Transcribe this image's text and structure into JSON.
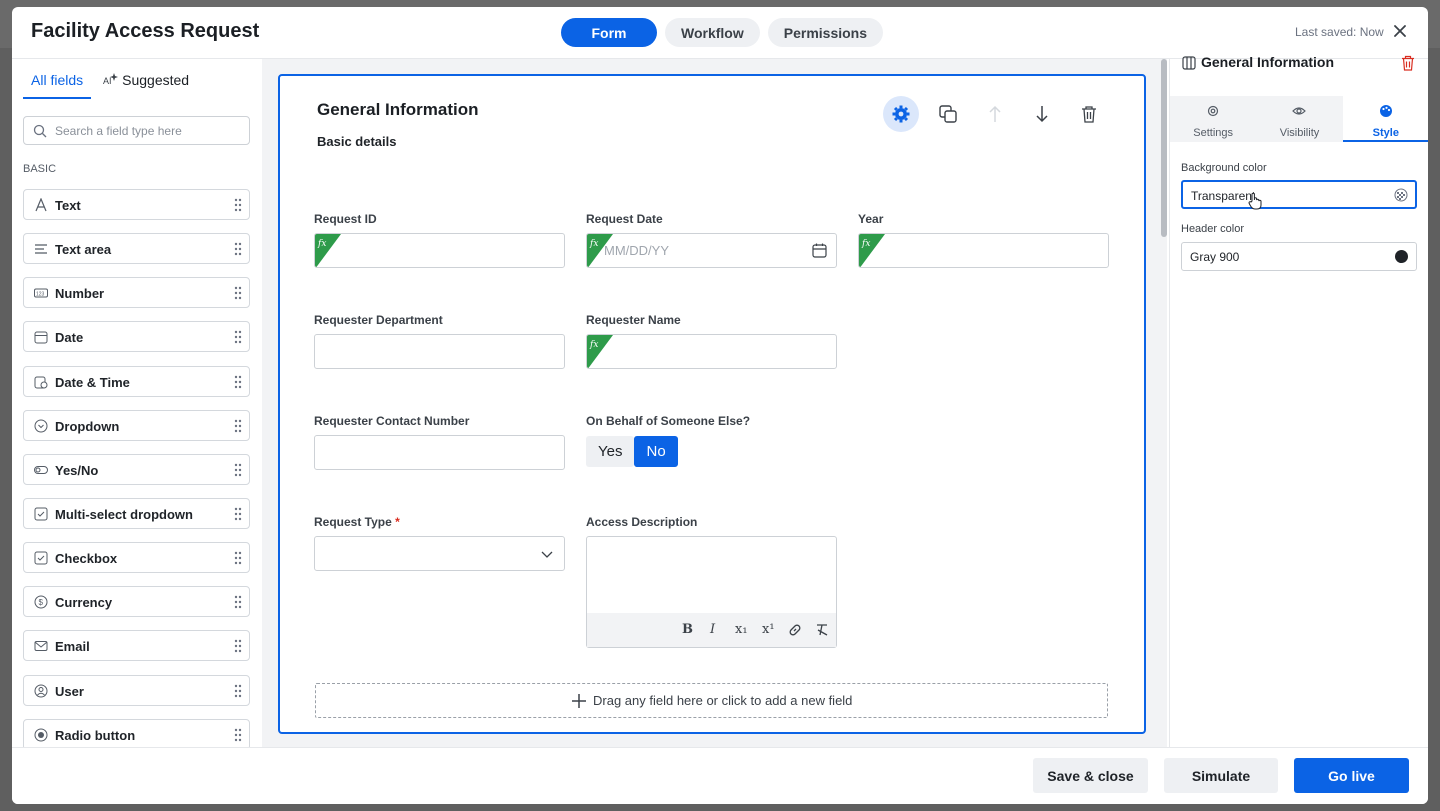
{
  "header": {
    "title": "Facility Access Request",
    "tabs": [
      "Form",
      "Workflow",
      "Permissions"
    ],
    "active_tab": "Form",
    "saved_status": "Last saved: Now"
  },
  "left_panel": {
    "tabs": [
      "All fields",
      "Suggested"
    ],
    "search_placeholder": "Search a field type here",
    "section_label": "BASIC",
    "field_types": [
      {
        "label": "Text",
        "icon": "text-icon"
      },
      {
        "label": "Text area",
        "icon": "textarea-icon"
      },
      {
        "label": "Number",
        "icon": "number-icon"
      },
      {
        "label": "Date",
        "icon": "calendar-icon"
      },
      {
        "label": "Date & Time",
        "icon": "datetime-icon"
      },
      {
        "label": "Dropdown",
        "icon": "dropdown-icon"
      },
      {
        "label": "Yes/No",
        "icon": "toggle-icon"
      },
      {
        "label": "Multi-select dropdown",
        "icon": "multiselect-icon"
      },
      {
        "label": "Checkbox",
        "icon": "checkbox-icon"
      },
      {
        "label": "Currency",
        "icon": "currency-icon"
      },
      {
        "label": "Email",
        "icon": "email-icon"
      },
      {
        "label": "User",
        "icon": "user-icon"
      },
      {
        "label": "Radio button",
        "icon": "radio-icon"
      }
    ]
  },
  "section": {
    "title": "General Information",
    "subtitle": "Basic details",
    "fields": {
      "request_id": "Request ID",
      "request_date": "Request Date",
      "request_date_placeholder": "MM/DD/YY",
      "year": "Year",
      "requester_department": "Requester Department",
      "requester_name": "Requester Name",
      "requester_contact": "Requester Contact Number",
      "on_behalf": "On Behalf of Someone Else?",
      "yes": "Yes",
      "no": "No",
      "request_type": "Request Type",
      "required_mark": "*",
      "access_description": "Access Description",
      "formula_glyph": "fx"
    },
    "rich_text_tools": [
      "B",
      "I",
      "x₁",
      "x¹"
    ],
    "dropzone": "Drag any field here or click to add a new field"
  },
  "right_panel": {
    "title": "General Information",
    "tabs": [
      "Settings",
      "Visibility",
      "Style"
    ],
    "active_tab": "Style",
    "background_color_label": "Background color",
    "background_color_value": "Transparent",
    "header_color_label": "Header color",
    "header_color_value": "Gray 900",
    "header_color_hex": "#1f2328"
  },
  "footer": {
    "save_close": "Save & close",
    "simulate": "Simulate",
    "go_live": "Go live"
  },
  "colors": {
    "accent": "#0b63e5",
    "formula": "#2e9b4a",
    "danger": "#d92d20"
  }
}
